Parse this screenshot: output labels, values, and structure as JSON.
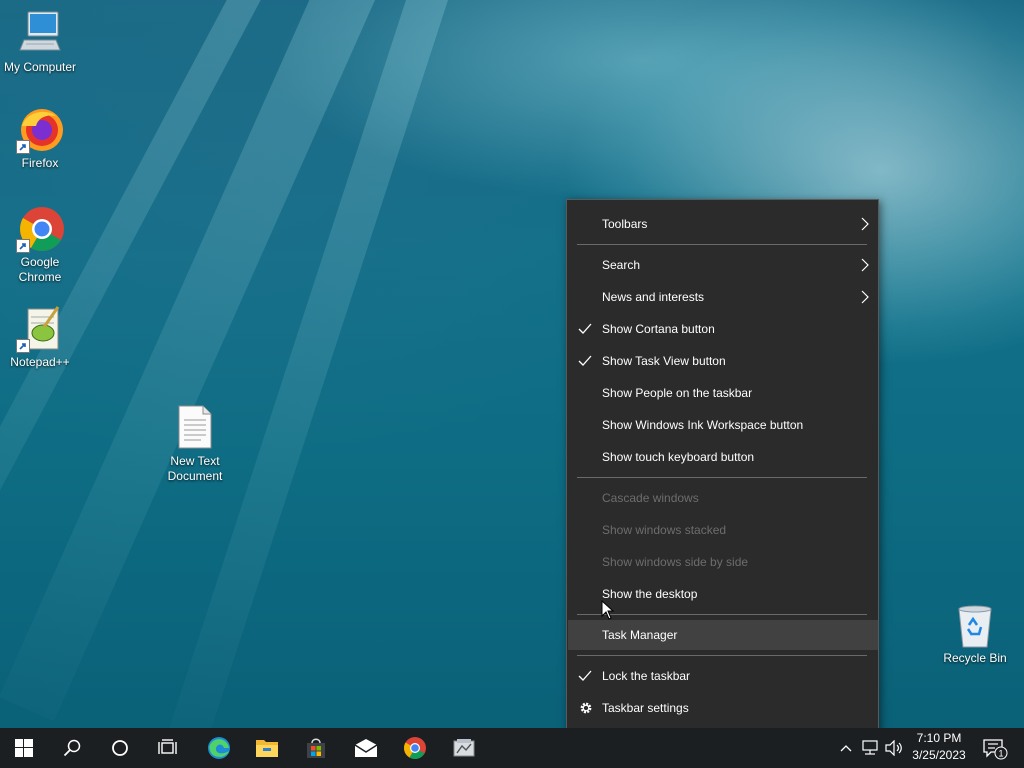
{
  "desktop": {
    "icons": [
      {
        "label_1": "My Computer",
        "label_2": ""
      },
      {
        "label_1": "Firefox",
        "label_2": ""
      },
      {
        "label_1": "Google",
        "label_2": "Chrome"
      },
      {
        "label_1": "Notepad++",
        "label_2": ""
      },
      {
        "label_1": "New Text",
        "label_2": "Document"
      },
      {
        "label_1": "Recycle Bin",
        "label_2": ""
      }
    ]
  },
  "context_menu": {
    "items": [
      {
        "label": "Toolbars",
        "checked": false,
        "submenu": true,
        "enabled": true
      },
      {
        "label": "Search",
        "checked": false,
        "submenu": true,
        "enabled": true
      },
      {
        "label": "News and interests",
        "checked": false,
        "submenu": true,
        "enabled": true
      },
      {
        "label": "Show Cortana button",
        "checked": true,
        "submenu": false,
        "enabled": true
      },
      {
        "label": "Show Task View button",
        "checked": true,
        "submenu": false,
        "enabled": true
      },
      {
        "label": "Show People on the taskbar",
        "checked": false,
        "submenu": false,
        "enabled": true
      },
      {
        "label": "Show Windows Ink Workspace button",
        "checked": false,
        "submenu": false,
        "enabled": true
      },
      {
        "label": "Show touch keyboard button",
        "checked": false,
        "submenu": false,
        "enabled": true
      },
      {
        "label": "Cascade windows",
        "checked": false,
        "submenu": false,
        "enabled": false
      },
      {
        "label": "Show windows stacked",
        "checked": false,
        "submenu": false,
        "enabled": false
      },
      {
        "label": "Show windows side by side",
        "checked": false,
        "submenu": false,
        "enabled": false
      },
      {
        "label": "Show the desktop",
        "checked": false,
        "submenu": false,
        "enabled": true
      },
      {
        "label": "Task Manager",
        "checked": false,
        "submenu": false,
        "enabled": true,
        "highlighted": true
      },
      {
        "label": "Lock the taskbar",
        "checked": true,
        "submenu": false,
        "enabled": true
      },
      {
        "label": "Taskbar settings",
        "checked": false,
        "submenu": false,
        "enabled": true,
        "icon": "gear-icon"
      }
    ]
  },
  "taskbar": {
    "pinned": [
      "start-icon",
      "search-icon",
      "cortana-icon",
      "task-view-icon",
      "edge-icon",
      "file-explorer-icon",
      "store-icon",
      "mail-icon",
      "chrome-icon",
      "app-icon"
    ],
    "clock": {
      "time": "7:10 PM",
      "date": "3/25/2023"
    },
    "notification_count": "1"
  },
  "colors": {
    "menu_bg": "#2b2b2b",
    "menu_hover": "#414141",
    "disabled_text": "#6d6d6d",
    "taskbar_bg": "#1c1f22"
  }
}
